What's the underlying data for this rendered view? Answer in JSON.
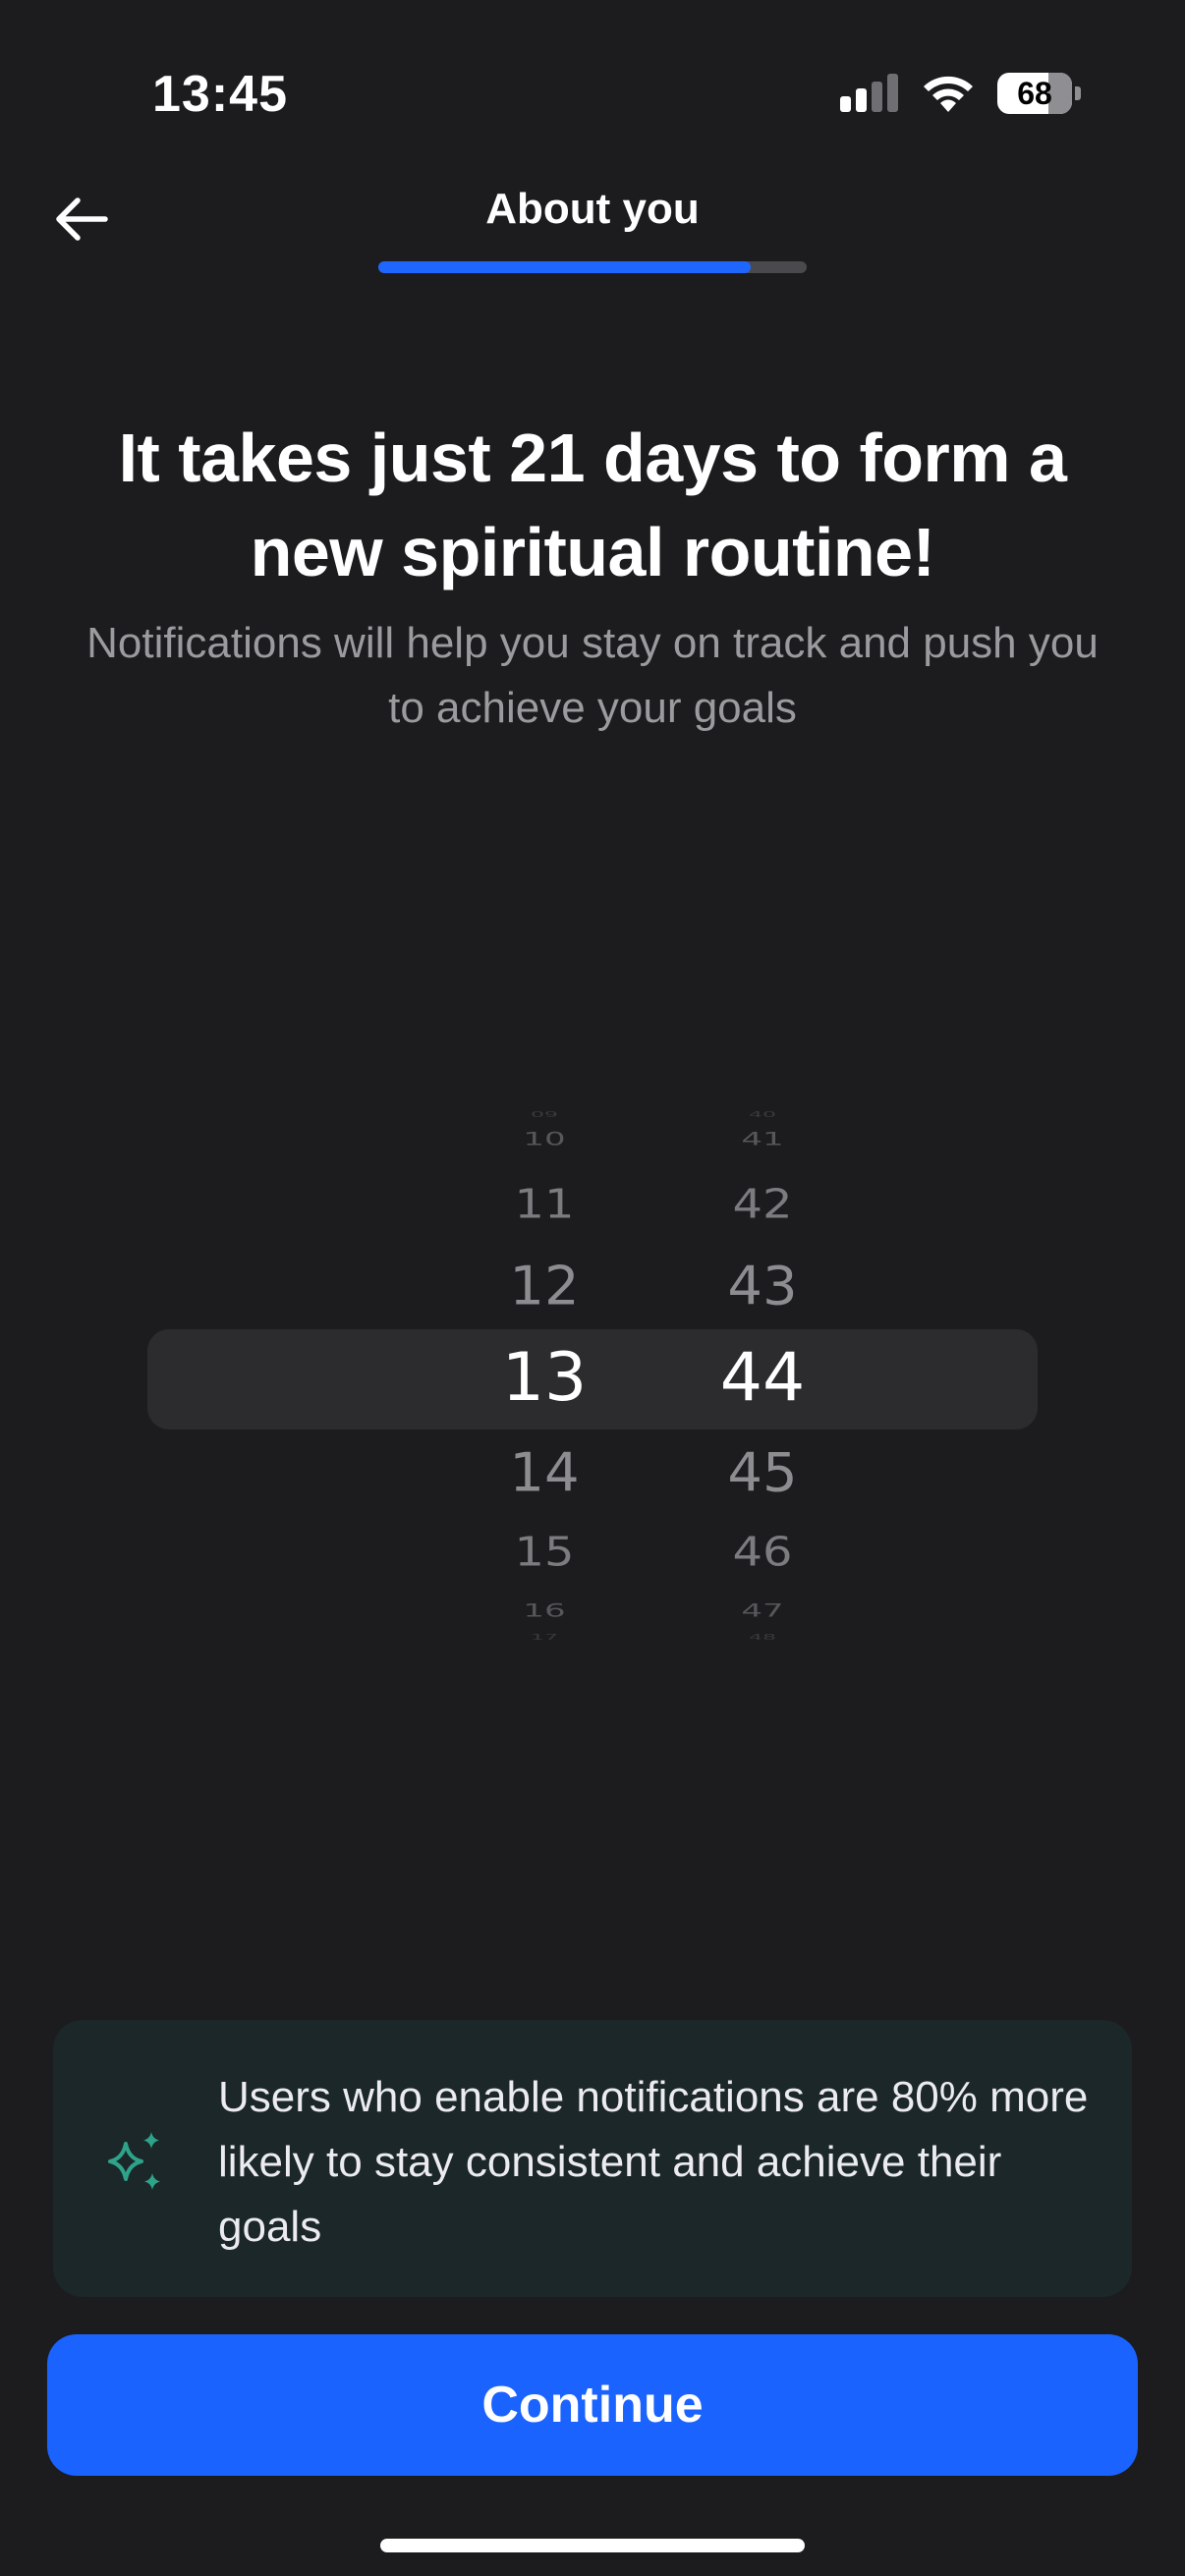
{
  "status_bar": {
    "time": "13:45",
    "battery": "68",
    "battery_level": 0.68,
    "icons": [
      "cellular-signal-icon",
      "wifi-icon",
      "battery-icon"
    ]
  },
  "header": {
    "back_icon": "arrow-left-icon",
    "title": "About you",
    "progress": 0.87
  },
  "headline": "It takes just 21 days to form a new spiritual routine!",
  "subtext": "Notifications will help you stay on track and push you to achieve your goals",
  "time_picker": {
    "hours": [
      "09",
      "10",
      "11",
      "12",
      "13",
      "14",
      "15",
      "16",
      "17"
    ],
    "minutes": [
      "40",
      "41",
      "42",
      "43",
      "44",
      "45",
      "46",
      "47",
      "48"
    ],
    "selected_hour": "13",
    "selected_minute": "44"
  },
  "tip": {
    "icon": "sparkles-icon",
    "text": "Users who enable notifications are 80% more likely to stay consistent and achieve their goals"
  },
  "continue_label": "Continue",
  "colors": {
    "background": "#1c1c1e",
    "accent": "#1a63ff",
    "tip_background": "#1b2728",
    "sparkle": "#2fa38a"
  }
}
